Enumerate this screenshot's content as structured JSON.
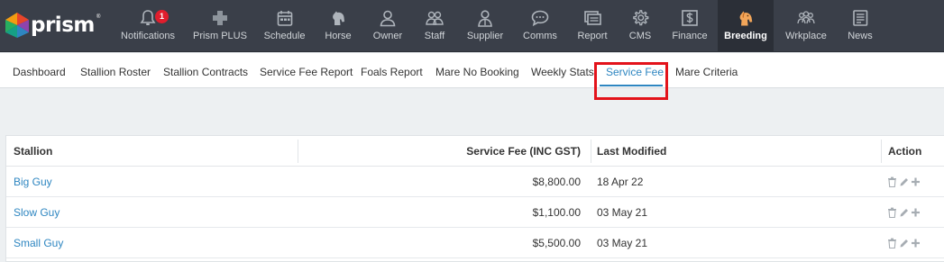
{
  "app": {
    "logo_text": "prism",
    "logo_reg": "®"
  },
  "topnav": {
    "notification_count": "1",
    "items": [
      {
        "label": "Notifications",
        "icon": "bell-icon"
      },
      {
        "label": "Prism PLUS",
        "icon": "plus-cross-icon"
      },
      {
        "label": "Schedule",
        "icon": "calendar-icon"
      },
      {
        "label": "Horse",
        "icon": "horse-head-icon"
      },
      {
        "label": "Owner",
        "icon": "user-icon"
      },
      {
        "label": "Staff",
        "icon": "users-icon"
      },
      {
        "label": "Supplier",
        "icon": "supplier-icon"
      },
      {
        "label": "Comms",
        "icon": "chat-icon"
      },
      {
        "label": "Report",
        "icon": "report-icon"
      },
      {
        "label": "CMS",
        "icon": "gear-icon"
      },
      {
        "label": "Finance",
        "icon": "money-icon"
      },
      {
        "label": "Breeding",
        "icon": "breeding-icon"
      },
      {
        "label": "Wrkplace",
        "icon": "workplace-icon"
      },
      {
        "label": "News",
        "icon": "news-icon"
      }
    ],
    "active": "Breeding"
  },
  "subnav": {
    "tabs": [
      "Dashboard",
      "Stallion Roster",
      "Stallion Contracts",
      "Service Fee Report",
      "Foals Report",
      "Mare No Booking",
      "Weekly Stats",
      "Service Fee",
      "Mare Criteria"
    ],
    "active": "Service Fee"
  },
  "table": {
    "headers": {
      "stallion": "Stallion",
      "fee": "Service Fee (INC GST)",
      "modified": "Last Modified",
      "action": "Action"
    },
    "rows": [
      {
        "stallion": "Big Guy",
        "fee": "$8,800.00",
        "modified": "18 Apr 22"
      },
      {
        "stallion": "Slow Guy",
        "fee": "$1,100.00",
        "modified": "03 May 21"
      },
      {
        "stallion": "Small Guy",
        "fee": "$5,500.00",
        "modified": "03 May 21"
      }
    ],
    "action_icons": [
      "trash-icon",
      "pencil-icon",
      "plus-icon"
    ]
  },
  "colors": {
    "nav_bg": "#3a3f49",
    "nav_active_bg": "#2b2f37",
    "accent": "#2e86c1",
    "highlight": "#e3131b",
    "badge": "#e01e2d"
  }
}
